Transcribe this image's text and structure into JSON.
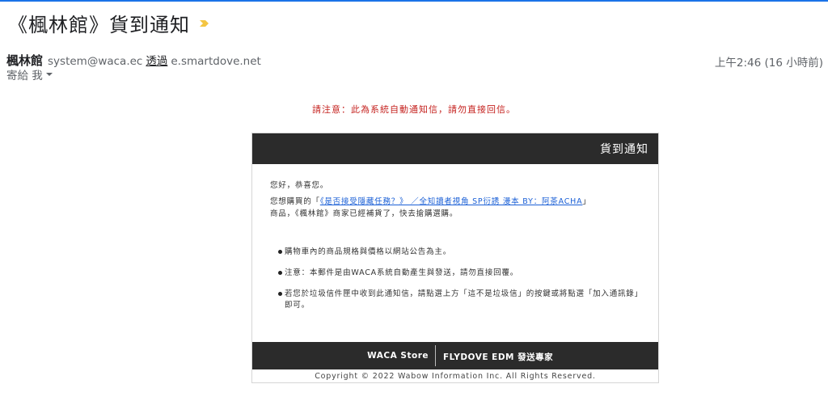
{
  "email": {
    "subject": "《楓林館》貨到通知",
    "sender_name": "楓林館",
    "sender_email": "system@waca.ec",
    "via_label": "透過",
    "via_domain": "e.smartdove.net",
    "to_label": "寄給 我",
    "timestamp": "上午2:46 (16 小時前)"
  },
  "notice": "請注意：此為系統自動通知信，請勿直接回信。",
  "card": {
    "header_title": "貨到通知",
    "greeting": "您好，恭喜您。",
    "purchase_prefix": "您想購買的「",
    "product_name": "《是否接受隱藏任務？》 ／全知讀者視角 SP衍誘 漫本 BY：阿茶ACHA",
    "purchase_suffix": "」",
    "purchase_line2": "商品，《楓林館》商家已經補貨了，快去搶購選購。",
    "bullets": [
      "購物車內的商品規格與價格以網站公告為主。",
      "注意：本郵件是由WACA系統自動產生與發送，請勿直接回覆。",
      "若您於垃圾信件匣中收到此通知信，請點選上方「這不是垃圾信」的按鍵或將點選「加入通訊錄」即可。"
    ],
    "footer_left": "WACA Store",
    "footer_right": "FLYDOVE EDM 發送專家",
    "copyright": "Copyright © 2022 Wabow Information Inc. All Rights Reserved."
  },
  "colors": {
    "accent": "#1a73e8",
    "notice_red": "#c5221f",
    "card_dark": "#2b2b2b",
    "important_yellow": "#f4c542",
    "link_blue": "#1a5fd6"
  },
  "icons": [
    "important-marker-icon",
    "dropdown-caret-icon"
  ]
}
